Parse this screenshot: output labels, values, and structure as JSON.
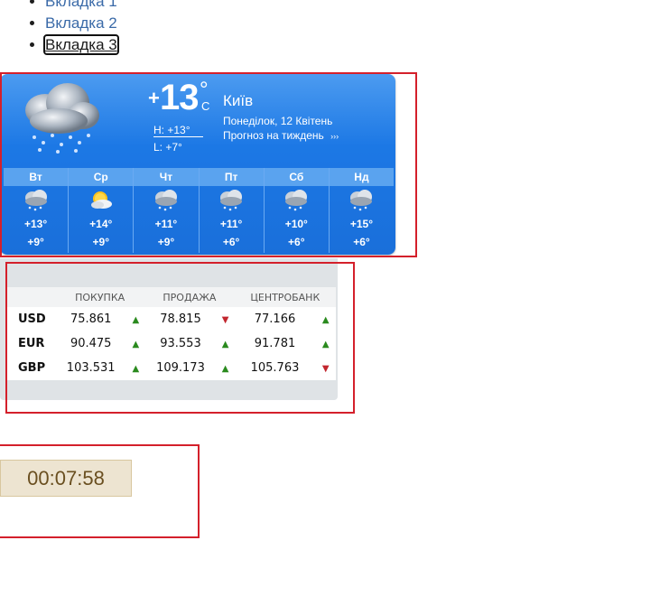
{
  "tabs": [
    {
      "label": "Вкладка 1"
    },
    {
      "label": "Вкладка 2"
    },
    {
      "label": "Вкладка 3"
    }
  ],
  "weather": {
    "current_sign": "+",
    "current_temp": "13",
    "degree_symbol": "°",
    "unit": "C",
    "city": "Київ",
    "date": "Понеділок, 12 Квітень",
    "forecast_link": "Прогноз на тиждень",
    "forecast_arrow": "›››",
    "high": "H: +13°",
    "low": "L: +7°",
    "days": [
      {
        "name": "Вт",
        "icon": "rain-cloud-icon",
        "high": "+13°",
        "low": "+9°"
      },
      {
        "name": "Ср",
        "icon": "sun-cloud-icon",
        "high": "+14°",
        "low": "+9°"
      },
      {
        "name": "Чт",
        "icon": "rain-cloud-icon",
        "high": "+11°",
        "low": "+9°"
      },
      {
        "name": "Пт",
        "icon": "rain-cloud-icon",
        "high": "+11°",
        "low": "+6°"
      },
      {
        "name": "Сб",
        "icon": "rain-cloud-icon",
        "high": "+10°",
        "low": "+6°"
      },
      {
        "name": "Нд",
        "icon": "rain-cloud-icon",
        "high": "+15°",
        "low": "+6°"
      }
    ]
  },
  "currency": {
    "headers": {
      "buy": "ПОКУПКА",
      "sell": "ПРОДАЖА",
      "central": "ЦЕНТРОБАНК"
    },
    "rows": [
      {
        "code": "USD",
        "buy": "75.861",
        "buy_dir": "up",
        "sell": "78.815",
        "sell_dir": "down",
        "central": "77.166",
        "central_dir": "up"
      },
      {
        "code": "EUR",
        "buy": "90.475",
        "buy_dir": "up",
        "sell": "93.553",
        "sell_dir": "up",
        "central": "91.781",
        "central_dir": "up"
      },
      {
        "code": "GBP",
        "buy": "103.531",
        "buy_dir": "up",
        "sell": "109.173",
        "sell_dir": "up",
        "central": "105.763",
        "central_dir": "down"
      }
    ],
    "colors": {
      "up": "#2a8a1e",
      "down": "#c2262e"
    }
  },
  "timer": {
    "value": "00:07:58"
  }
}
